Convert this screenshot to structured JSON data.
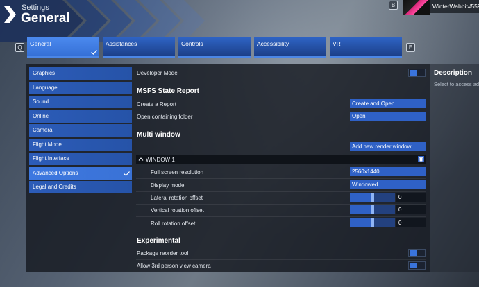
{
  "header": {
    "settings_label": "Settings",
    "title": "General",
    "key_left": "Q",
    "key_right": "E",
    "key_back": "B",
    "username": "WinterWabbit#559"
  },
  "tabs": [
    {
      "label": "General",
      "active": true
    },
    {
      "label": "Assistances",
      "active": false
    },
    {
      "label": "Controls",
      "active": false
    },
    {
      "label": "Accessibility",
      "active": false
    },
    {
      "label": "VR",
      "active": false
    }
  ],
  "categories": [
    {
      "label": "Graphics",
      "active": false
    },
    {
      "label": "Language",
      "active": false
    },
    {
      "label": "Sound",
      "active": false
    },
    {
      "label": "Online",
      "active": false
    },
    {
      "label": "Camera",
      "active": false
    },
    {
      "label": "Flight Model",
      "active": false
    },
    {
      "label": "Flight Interface",
      "active": false
    },
    {
      "label": "Advanced Options",
      "active": true
    },
    {
      "label": "Legal and Credits",
      "active": false
    }
  ],
  "settings": {
    "developer_mode": {
      "label": "Developer Mode",
      "enabled": true
    },
    "msfs_state_report": {
      "title": "MSFS State Report",
      "create_report_label": "Create a Report",
      "create_report_button": "Create and Open",
      "open_folder_label": "Open containing folder",
      "open_folder_button": "Open"
    },
    "multi_window": {
      "title": "Multi window",
      "add_button": "Add new render window",
      "window_title": "WINDOW 1",
      "full_screen_resolution": {
        "label": "Full screen resolution",
        "value": "2560x1440"
      },
      "display_mode": {
        "label": "Display mode",
        "value": "Windowed"
      },
      "lateral_rotation_offset": {
        "label": "Lateral rotation offset",
        "value": "0",
        "slider_fraction": 0.5
      },
      "vertical_rotation_offset": {
        "label": "Vertical rotation offset",
        "value": "0",
        "slider_fraction": 0.5
      },
      "roll_rotation_offset": {
        "label": "Roll rotation offset",
        "value": "0",
        "slider_fraction": 0.5
      }
    },
    "experimental": {
      "title": "Experimental",
      "package_reorder_tool": {
        "label": "Package reorder tool",
        "enabled": true
      },
      "third_person_view_camera": {
        "label": "Allow 3rd person view camera",
        "enabled": true
      }
    }
  },
  "description": {
    "title": "Description",
    "text": "Select to access ad"
  },
  "colors": {
    "accent": "#2f61c6",
    "accent_active": "#3d78e0",
    "panel_bg": "#161a21"
  }
}
